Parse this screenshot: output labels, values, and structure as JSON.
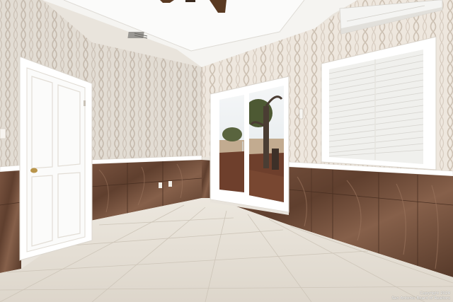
{
  "watermark": {
    "line1": "Copyright 2024",
    "line2": "San Antonio Board of Realtors"
  },
  "colors": {
    "wallpaper": "#ece5dc",
    "wallpaper_trellis": "#cfc3b6",
    "wainscot_marble": "#6e4a36",
    "trim": "#ffffff",
    "floor_tile": "#e6e0d6",
    "ceiling": "#f7f6f3"
  }
}
